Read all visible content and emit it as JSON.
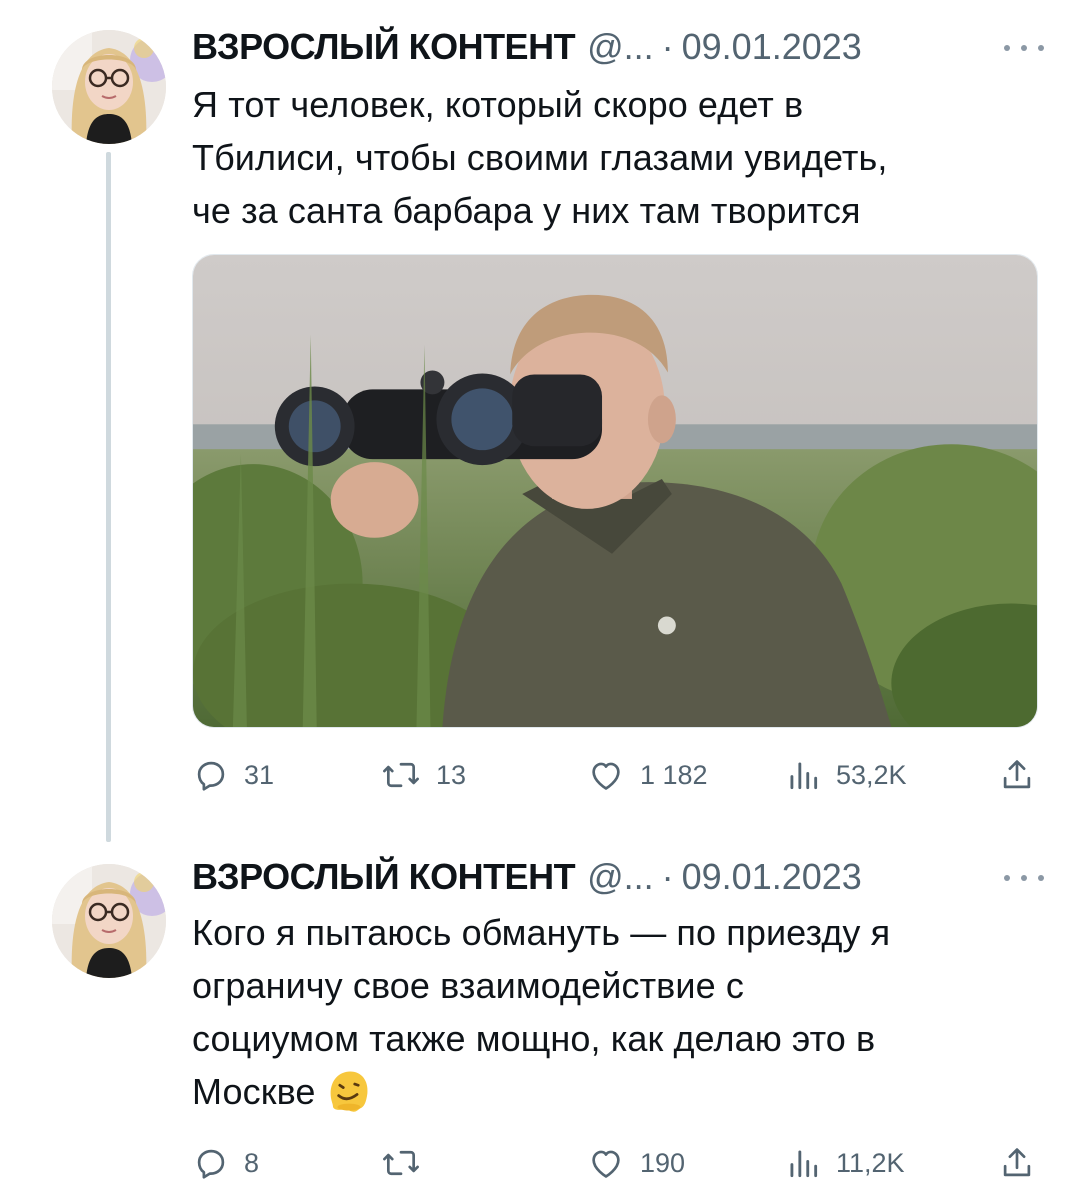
{
  "tweets": [
    {
      "author_name": "ВЗРОСЛЫЙ КОНТЕНТ",
      "handle": "@...",
      "separator": "·",
      "date": "09.01.2023",
      "text_lines": [
        "Я тот человек, который скоро едет в",
        "Тбилиси, чтобы своими глазами увидеть,",
        "че за санта барбара у них там творится"
      ],
      "media": {
        "kind": "photo",
        "icon": "photo"
      },
      "stats": {
        "replies": "31",
        "retweets": "13",
        "likes": "1 182",
        "views": "53,2K"
      }
    },
    {
      "author_name": "ВЗРОСЛЫЙ КОНТЕНТ",
      "handle": "@...",
      "separator": "·",
      "date": "09.01.2023",
      "text_lines": [
        "Кого я пытаюсь обмануть — по приезду я",
        "ограничу свое взаимодействие с",
        "социумом также мощно, как делаю это в",
        "Москве"
      ],
      "emoji": "melting-face-emoji",
      "stats": {
        "replies": "8",
        "retweets": "",
        "likes": "190",
        "views": "11,2K"
      }
    }
  ],
  "icons": {
    "reply": "reply-icon",
    "retweet": "retweet-icon",
    "like": "heart-icon",
    "views": "views-icon",
    "share": "share-icon",
    "more": "more-icon"
  },
  "colors": {
    "text": "#0f1419",
    "secondary": "#536471",
    "thread_line": "#cfd9de",
    "background": "#ffffff"
  }
}
